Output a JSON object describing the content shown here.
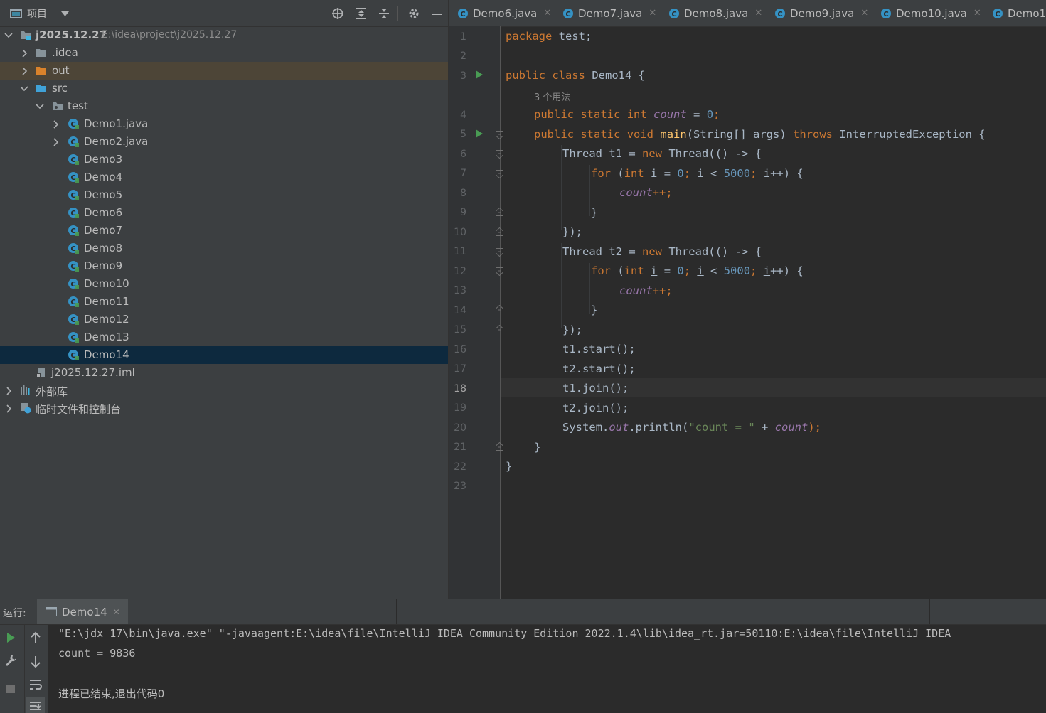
{
  "project": {
    "header_title": "项目",
    "tree": [
      {
        "label": "j2025.12.27",
        "hint": "E:\\idea\\project\\j2025.12.27"
      },
      {
        "label": ".idea"
      },
      {
        "label": "out"
      },
      {
        "label": "src"
      },
      {
        "label": "test"
      },
      {
        "label": "Demo1.java"
      },
      {
        "label": "Demo2.java"
      },
      {
        "label": "Demo3"
      },
      {
        "label": "Demo4"
      },
      {
        "label": "Demo5"
      },
      {
        "label": "Demo6"
      },
      {
        "label": "Demo7"
      },
      {
        "label": "Demo8"
      },
      {
        "label": "Demo9"
      },
      {
        "label": "Demo10"
      },
      {
        "label": "Demo11"
      },
      {
        "label": "Demo12"
      },
      {
        "label": "Demo13"
      },
      {
        "label": "Demo14"
      },
      {
        "label": "j2025.12.27.iml"
      },
      {
        "label": "外部库"
      },
      {
        "label": "临时文件和控制台"
      }
    ]
  },
  "tabs": [
    "Demo6.java",
    "Demo7.java",
    "Demo8.java",
    "Demo9.java",
    "Demo10.java",
    "Demo1"
  ],
  "editor": {
    "line_numbers": [
      "1",
      "2",
      "3",
      "4",
      "5",
      "6",
      "7",
      "8",
      "9",
      "10",
      "11",
      "12",
      "13",
      "14",
      "15",
      "16",
      "17",
      "18",
      "19",
      "20",
      "21",
      "22",
      "23"
    ],
    "usage_hint": "3 个用法",
    "code": {
      "package_kw": "package",
      "package_name": " test;",
      "public": "public",
      "class": "class",
      "static": "static",
      "int": "int",
      "void": "void",
      "new": "new",
      "for": "for",
      "throws": "throws",
      "class_name": " Demo14 {",
      "count": "count",
      "zero": "0",
      "limit": "5000",
      "main": "main",
      "main_params": "(String[] args) ",
      "exception": " InterruptedException {",
      "thread_t1": "Thread t1 = ",
      "thread_t2": "Thread t2 = ",
      "thread_ctor": " Thread(() -> {",
      "loop_open": " (",
      "loop_i": "i",
      "loop_eq": " = ",
      "loop_lt": " < ",
      "loop_inc": "++) {",
      "semi": "; ",
      "plusplus": "++;",
      "brace_close": "}",
      "lambda_close": "});",
      "t1_start": "t1.start();",
      "t2_start": "t2.start();",
      "t1_join": "t1.join();",
      "t2_join": "t2.join();",
      "sysout_a": "System.",
      "sysout_out": "out",
      "sysout_b": ".println(",
      "sysout_str": "\"count = \"",
      "sysout_plus": " + ",
      "sysout_end": ");",
      "assign_zero_prefix": " = ",
      "assign_zero_suffix": ";"
    }
  },
  "run": {
    "label": "运行:",
    "tab_label": "Demo14",
    "console": [
      "\"E:\\jdx 17\\bin\\java.exe\" \"-javaagent:E:\\idea\\file\\IntelliJ IDEA Community Edition 2022.1.4\\lib\\idea_rt.jar=50110:E:\\idea\\file\\IntelliJ IDEA",
      "count = 9836",
      "进程已结束,退出代码0"
    ]
  },
  "icons": [
    "project-icon",
    "chevron-down-icon",
    "locate-icon",
    "expand-all-icon",
    "collapse-all-icon",
    "gear-icon",
    "minimize-icon",
    "folder-icon",
    "class-icon",
    "run-icon",
    "rerun-icon",
    "wrench-icon",
    "stop-icon",
    "arrow-up-icon",
    "arrow-down-icon",
    "soft-wrap-icon",
    "scroll-end-icon"
  ],
  "colors": {
    "keyword": "#cc7832",
    "number": "#6897bb",
    "string": "#6a8759",
    "field": "#9876aa",
    "method": "#ffc66d",
    "selection": "#0d293e",
    "excluded": "#4d4537",
    "run_green": "#499c54"
  }
}
